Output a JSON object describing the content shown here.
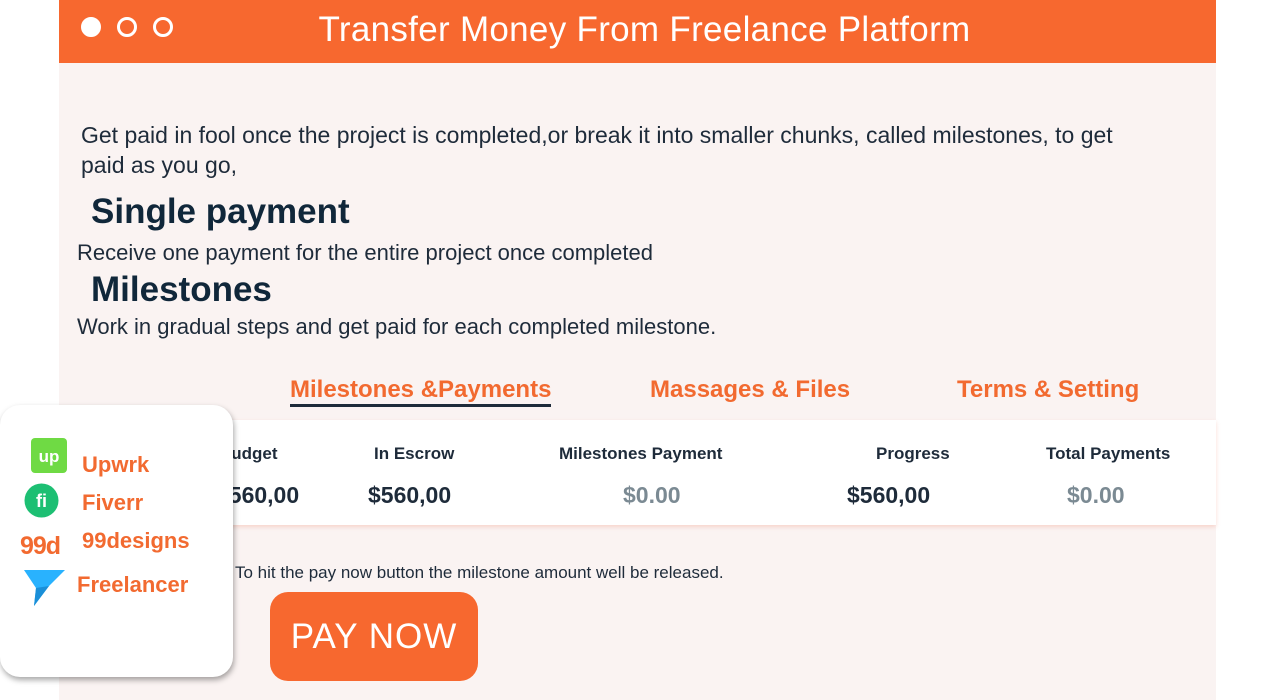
{
  "window": {
    "title": "Transfer Money From Freelance Platform",
    "accent_color": "#f7682f",
    "controls": [
      "window-dot-filled",
      "window-dot",
      "window-dot"
    ]
  },
  "intro_text": "Get paid in fool once the project is completed,or break it into smaller chunks, called milestones, to get paid as you go,",
  "options": [
    {
      "title": "Single payment",
      "description": "Receive one payment for the entire project once completed"
    },
    {
      "title": "Milestones",
      "description": "Work in gradual steps and get paid for each completed milestone."
    }
  ],
  "tabs": [
    {
      "label": "Milestones &Payments",
      "active": true
    },
    {
      "label": "Massages & Files",
      "active": false
    },
    {
      "label": "Terms & Setting",
      "active": false
    }
  ],
  "stats": [
    {
      "label": "Budget",
      "value": "$560,00"
    },
    {
      "label": "In Escrow",
      "value": "$560,00"
    },
    {
      "label": "Milestones Payment",
      "value": "$0.00"
    },
    {
      "label": "Progress",
      "value": "$560,00"
    },
    {
      "label": "Total Payments",
      "value": "$0.00"
    }
  ],
  "note": "To hit the pay now button the milestone amount well be released.",
  "pay_button": "PAY NOW",
  "platforms": [
    {
      "name": "Upwrk",
      "icon": "upwork-logo-icon",
      "icon_text": "up",
      "color": "#6fda44"
    },
    {
      "name": "Fiverr",
      "icon": "fiverr-logo-icon",
      "icon_text": "fi",
      "color": "#1dbf73"
    },
    {
      "name": "99designs",
      "icon": "99designs-logo-icon",
      "icon_text": "99d",
      "color": "#f26a30"
    },
    {
      "name": "Freelancer",
      "icon": "freelancer-logo-icon",
      "color": "#29b2fe"
    }
  ]
}
